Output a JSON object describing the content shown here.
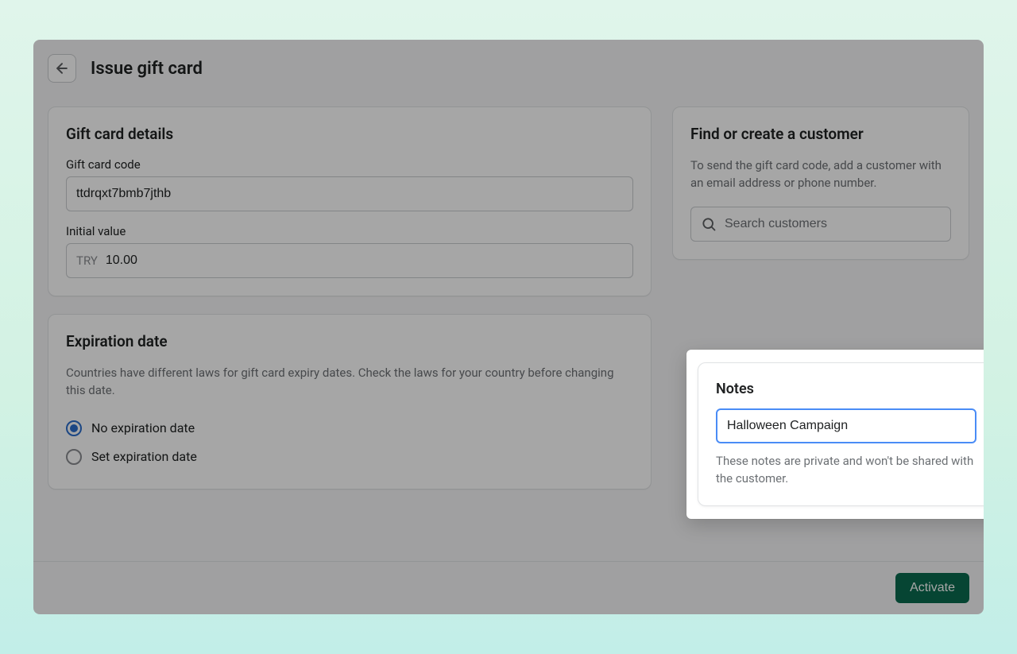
{
  "header": {
    "title": "Issue gift card"
  },
  "details_card": {
    "title": "Gift card details",
    "code_label": "Gift card code",
    "code_value": "ttdrqxt7bmb7jthb",
    "initial_value_label": "Initial value",
    "currency_prefix": "TRY",
    "initial_value": "10.00"
  },
  "expiration_card": {
    "title": "Expiration date",
    "helper": "Countries have different laws for gift card expiry dates. Check the laws for your country before changing this date.",
    "options": {
      "no_expiry": "No expiration date",
      "set_expiry": "Set expiration date"
    }
  },
  "customer_card": {
    "title": "Find or create a customer",
    "helper": "To send the gift card code, add a customer with an email address or phone number.",
    "search_placeholder": "Search customers"
  },
  "notes_card": {
    "title": "Notes",
    "value": "Halloween Campaign",
    "sub": "These notes are private and won't be shared with the customer."
  },
  "footer": {
    "activate": "Activate"
  }
}
